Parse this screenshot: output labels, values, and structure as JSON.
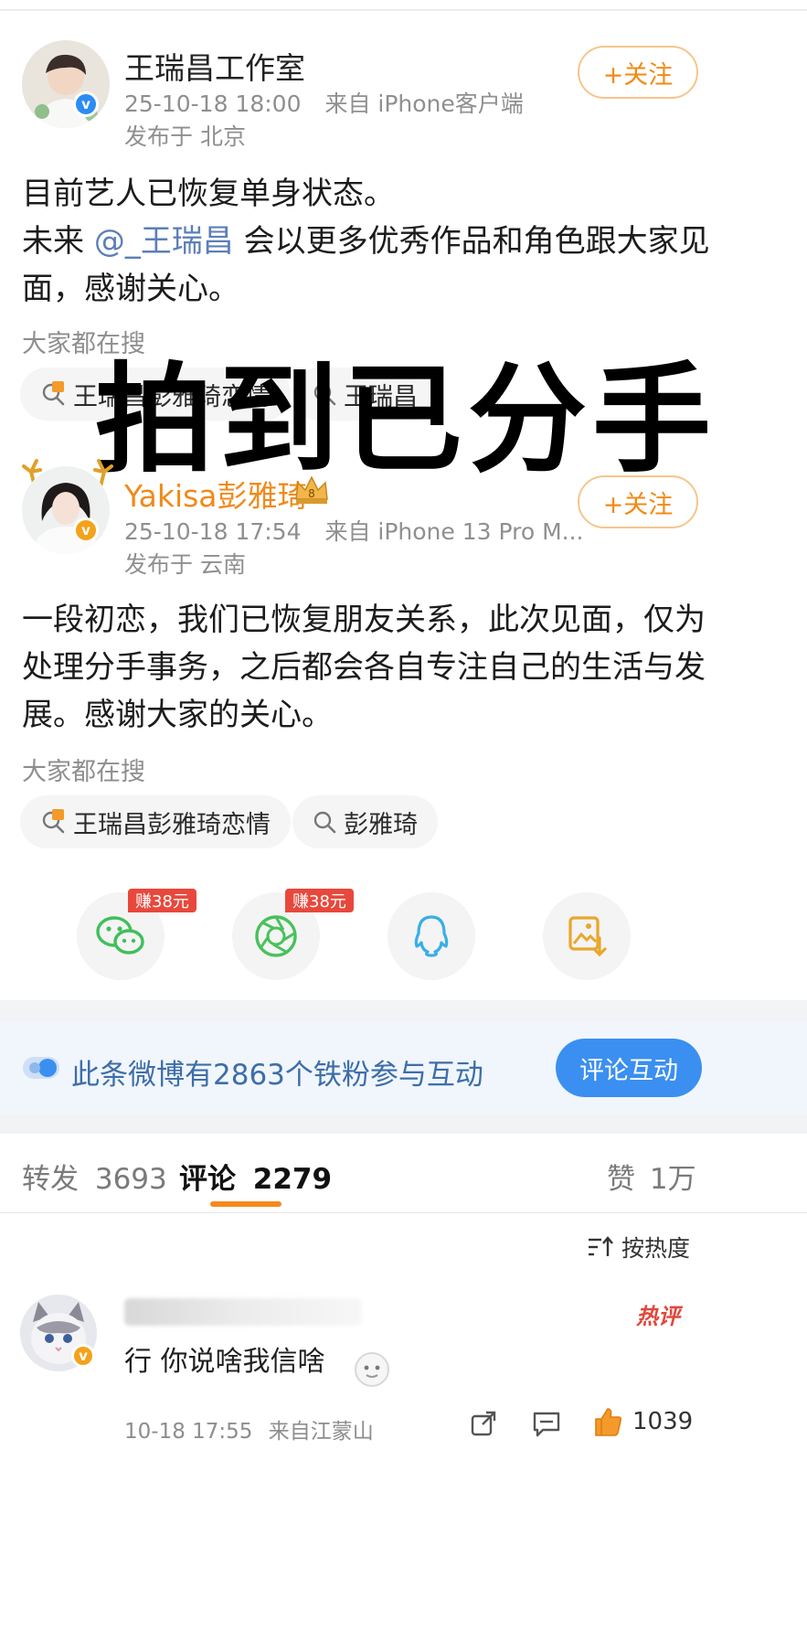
{
  "post1": {
    "author": "王瑞昌工作室",
    "timestamp": "25-10-18 18:00",
    "source": "来自 iPhone客户端",
    "location": "发布于 北京",
    "follow_label": "+关注",
    "line1": "目前艺人已恢复单身状态。",
    "line2_pre": "未来 ",
    "mention": "@_王瑞昌",
    "line2_post": " 会以更多优秀作品和角色跟大家见",
    "line3": "面，感谢关心。",
    "hot_label": "大家都在搜",
    "chips": [
      "王瑞昌彭雅琦恋情",
      "王瑞昌"
    ]
  },
  "overlay_caption": "拍到已分手",
  "post2": {
    "author": "Yakisa彭雅琦",
    "timestamp": "25-10-18 17:54",
    "source": "来自 iPhone 13 Pro M...",
    "location": "发布于 云南",
    "follow_label": "+关注",
    "line1": "一段初恋，我们已恢复朋友关系，此次见面，仅为",
    "line2": "处理分手事务，之后都会各自专注自己的生活与发",
    "line3": "展。感谢大家的关心。",
    "hot_label": "大家都在搜",
    "chips": [
      "王瑞昌彭雅琦恋情",
      "彭雅琦"
    ]
  },
  "share": {
    "earn_badge": "赚38元",
    "icons": [
      "wechat-icon",
      "moments-icon",
      "qq-icon",
      "save-image-icon"
    ]
  },
  "banner": {
    "text": "此条微博有2863个铁粉参与互动",
    "button": "评论互动"
  },
  "tabs": {
    "repost_label": "转发",
    "repost_count": "3693",
    "comment_label": "评论",
    "comment_count": "2279",
    "like_label": "赞",
    "like_count": "1万"
  },
  "sort_label": "按热度",
  "comment": {
    "hot_tag": "热评",
    "text": "行 你说啥我信啥",
    "timestamp": "10-18 17:55",
    "source": "来自江蒙山",
    "likes": "1039"
  },
  "colors": {
    "accent_orange": "#f28a14",
    "link_blue": "#5c7fb8",
    "button_blue": "#3a8ff0"
  }
}
